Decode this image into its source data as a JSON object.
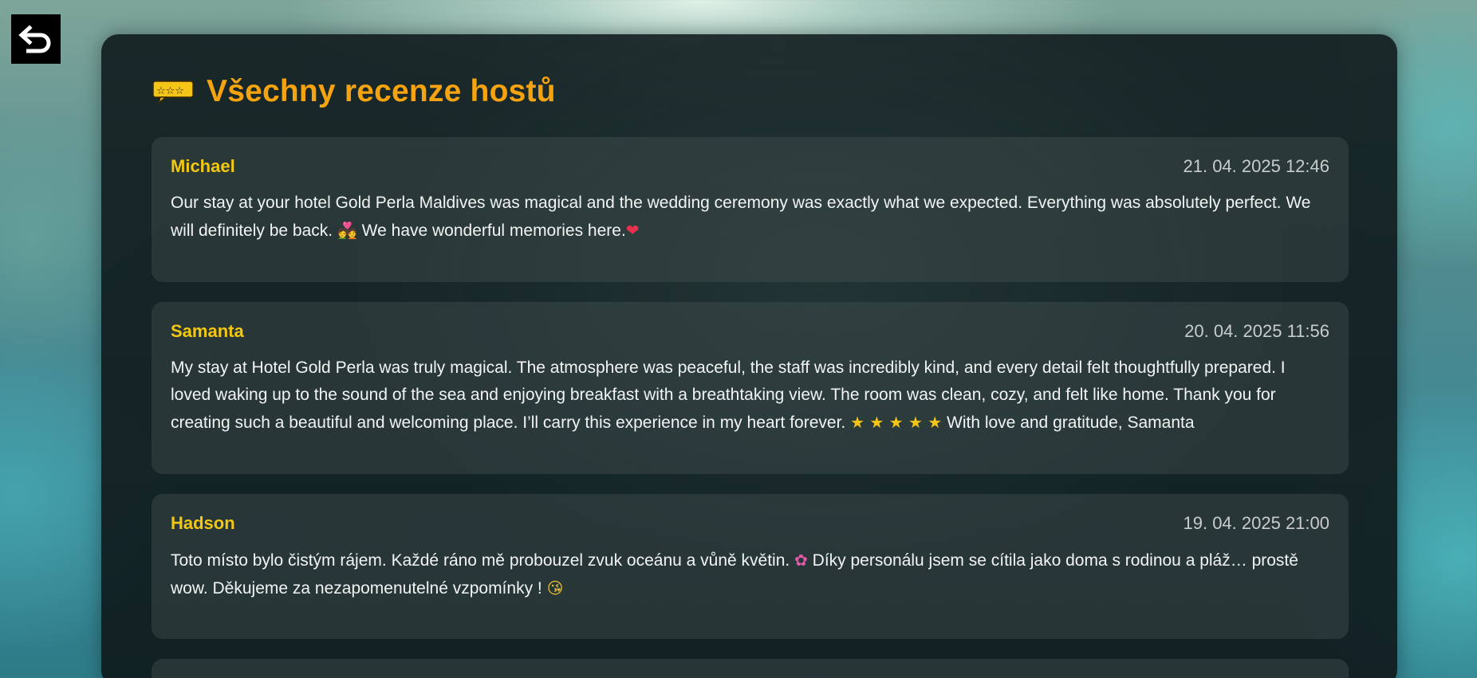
{
  "header": {
    "back_icon": "undo-arrow-icon",
    "title_icon": "speech-bubble-stars-icon",
    "title": "Všechny recenze hostů"
  },
  "colors": {
    "title": "#f5a30f",
    "name": "#f2c812",
    "date": "#c8cccc",
    "text": "#f2f4f4"
  },
  "reviews": [
    {
      "name": "Michael",
      "date": "21. 04. 2025 12:46",
      "text_1": "Our stay at your hotel Gold Perla Maldives was magical and the wedding ceremony was exactly what we expected. Everything was absolutely perfect. We will definitely be back. ",
      "emoji_1": "💑",
      "text_2": " We have wonderful memories here.",
      "emoji_2": "❤"
    },
    {
      "name": "Samanta",
      "date": "20. 04. 2025 11:56",
      "text_1": "My stay at Hotel Gold Perla was truly magical. The atmosphere was peaceful, the staff was incredibly kind, and every detail felt thoughtfully prepared. I loved waking up to the sound of the sea and enjoying breakfast with a breathtaking view. The room was clean, cozy, and felt like home. Thank you for creating such a beautiful and welcoming place. I’ll carry this experience in my heart forever. ",
      "emoji_1": "★ ★ ★ ★ ★",
      "text_2": " With love and gratitude, Samanta"
    },
    {
      "name": "Hadson",
      "date": "19. 04. 2025 21:00",
      "text_1": "Toto místo bylo čistým rájem. Každé ráno mě probouzel zvuk oceánu a vůně květin. ",
      "emoji_1": "✿",
      "text_2": "  Díky personálu jsem se cítila jako doma s rodinou a pláž… prostě wow. Děkujeme za nezapomenutelné vzpomínky ! ",
      "emoji_2": "😘"
    }
  ]
}
